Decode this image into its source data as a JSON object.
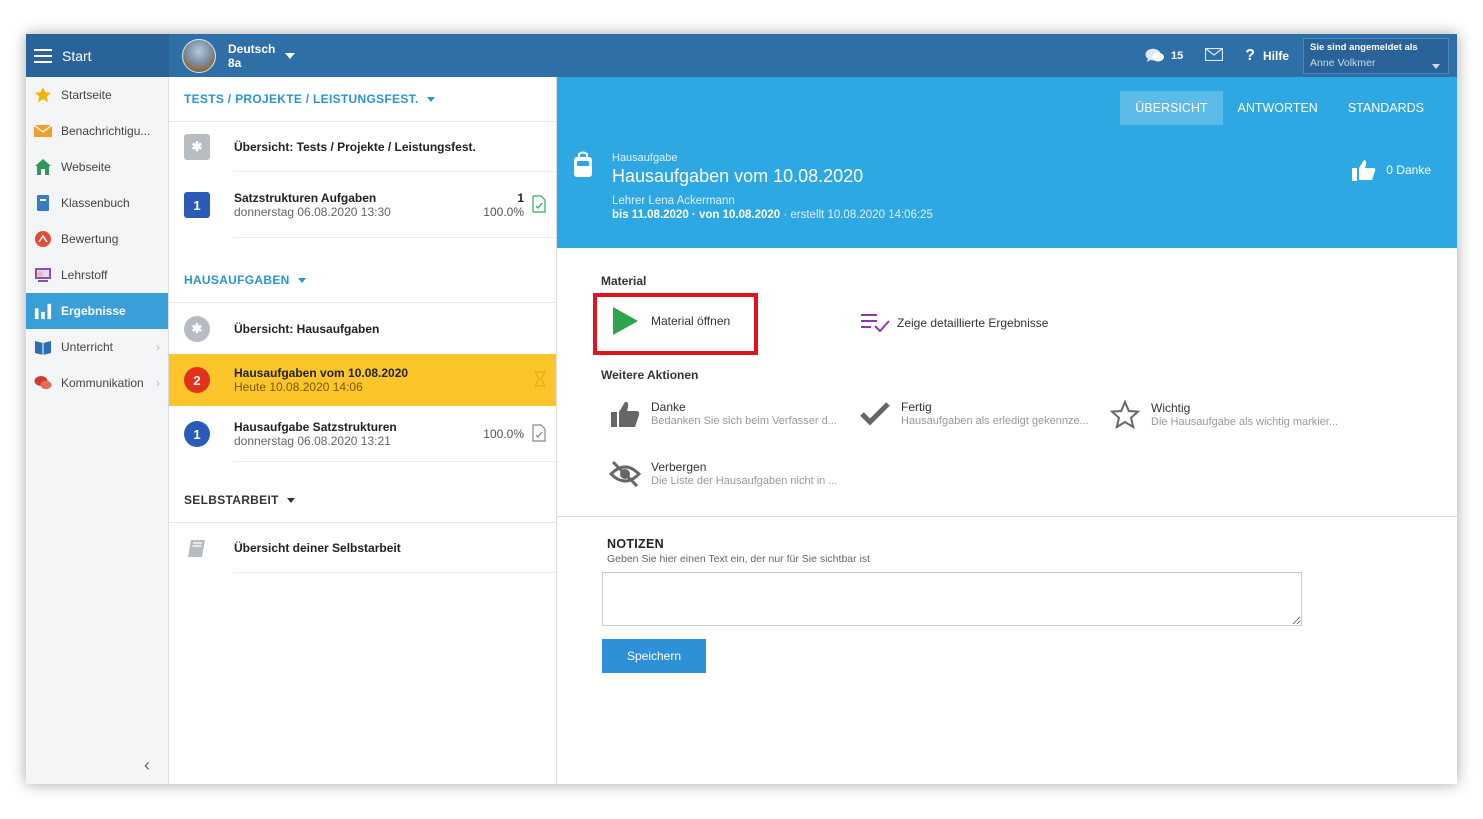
{
  "topbar": {
    "menu_label": "Start",
    "class_subject": "Deutsch",
    "class_name": "8a",
    "chat_count": "15",
    "help_label": "Hilfe",
    "login_label": "Sie sind angemeldet als",
    "login_user": "Anne Volkmer"
  },
  "sidebar": {
    "items": [
      {
        "label": "Startseite",
        "icon": "star-icon"
      },
      {
        "label": "Benachrichtigu...",
        "icon": "envelope-icon"
      },
      {
        "label": "Webseite",
        "icon": "house-icon"
      },
      {
        "label": "Klassenbuch",
        "icon": "book-icon"
      },
      {
        "label": "Bewertung",
        "icon": "rating-icon"
      },
      {
        "label": "Lehrstoff",
        "icon": "teaching-material-icon"
      },
      {
        "label": "Ergebnisse",
        "icon": "bar-chart-icon"
      },
      {
        "label": "Unterricht",
        "icon": "open-book-icon"
      },
      {
        "label": "Kommunikation",
        "icon": "chat-bubbles-icon"
      }
    ]
  },
  "list": {
    "tests_header": "TESTS / PROJEKTE / LEISTUNGSFEST.",
    "tests_overview": "Übersicht: Tests / Projekte / Leistungsfest.",
    "test1_title": "Satzstrukturen Aufgaben",
    "test1_date": "donnerstag 06.08.2020 13:30",
    "test1_count": "1",
    "test1_percent": "100.0%",
    "test1_badge": "1",
    "hw_header": "HAUSAUFGABEN",
    "hw_overview": "Übersicht: Hausaufgaben",
    "hw1_title": "Hausaufgaben vom 10.08.2020",
    "hw1_date": "Heute 10.08.2020 14:06",
    "hw1_badge": "2",
    "hw2_title": "Hausaufgabe Satzstrukturen",
    "hw2_date": "donnerstag 06.08.2020 13:21",
    "hw2_percent": "100.0%",
    "hw2_badge": "1",
    "self_header": "SELBSTARBEIT",
    "self_overview": "Übersicht deiner Selbstarbeit"
  },
  "detail": {
    "tabs": [
      "ÜBERSICHT",
      "ANTWORTEN",
      "STANDARDS"
    ],
    "kind": "Hausaufgabe",
    "title": "Hausaufgaben vom 10.08.2020",
    "teacher": "Lehrer Lena Ackermann",
    "due": "bis 11.08.2020",
    "from": " · von 10.08.2020",
    "created": " · erstellt 10.08.2020 14:06:25",
    "thanks": "0 Danke",
    "material_label": "Material",
    "open_material": "Material öffnen",
    "detailed_results": "Zeige detaillierte Ergebnisse",
    "more_actions_label": "Weitere Aktionen",
    "actions": [
      {
        "name": "Danke",
        "desc": "Bedanken Sie sich beim Verfasser d..."
      },
      {
        "name": "Fertig",
        "desc": "Hausaufgaben als erledigt gekennze..."
      },
      {
        "name": "Wichtig",
        "desc": "Die Hausaufgabe als wichtig markier..."
      },
      {
        "name": "Verbergen",
        "desc": "Die Liste der Hausaufgaben nicht in ..."
      }
    ],
    "notes_title": "NOTIZEN",
    "notes_sub": "Geben Sie hier einen Text ein, der nur für Sie sichtbar ist",
    "notes_value": "",
    "save_label": "Speichern"
  },
  "colors": {
    "topbar": "#2f6fa7",
    "accent_blue": "#2ea8e2",
    "selected_row": "#fcc52a",
    "highlight_box": "#e0141f",
    "play_green": "#2ea44f",
    "results_purple": "#8e3aa8"
  }
}
